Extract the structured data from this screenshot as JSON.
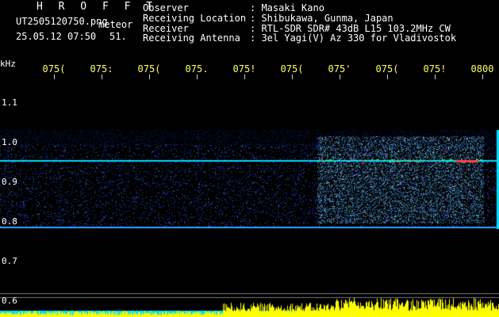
{
  "header": {
    "title": "H R O F F T",
    "filename": "UT2505120750.png",
    "meteor_label": "meteor",
    "date_time": "25.05.12 07:50",
    "count": "51.",
    "observer_label": "Observer",
    "observer": ": Masaki Kano",
    "location_label": "Receiving Location",
    "location": ": Shibukawa, Gunma, Japan",
    "receiver_label": "Receiver",
    "receiver": ": RTL-SDR SDR# 43dB L15 103.2MHz CW",
    "antenna_label": "Receiving Antenna",
    "antenna": ": 3el Yagi(V) Az 330 for Vladivostok"
  },
  "axis": {
    "unit": "kHz",
    "y_labels": [
      "1.1",
      "1.0",
      "0.9",
      "0.8",
      "0.7",
      "0.6"
    ],
    "x_labels": [
      "075(",
      "075:",
      "075(",
      "075.",
      "075!",
      "075(",
      "075'",
      "075(",
      "075!",
      "0800"
    ]
  },
  "colors": {
    "background": "#000000",
    "time_labels": "#ffff66",
    "header_text": "#ffffff",
    "signal_line": "#00e0ff",
    "hot_echo": "#ff3030",
    "band": "#1a3cc8",
    "footer_fill": "#ffff00"
  }
}
